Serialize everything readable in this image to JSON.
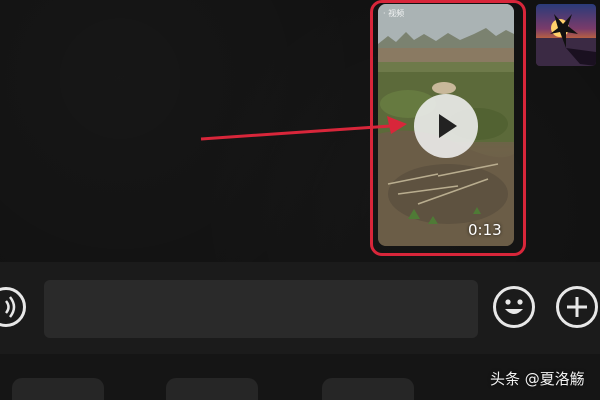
{
  "chat": {
    "video_message": {
      "duration": "0:13",
      "overlay_label": "· 视频",
      "highlight_color": "#d8263a"
    },
    "annotation_arrow_color": "#d8263a"
  },
  "input_bar": {
    "voice_icon": "voice-wave-icon",
    "message_value": "",
    "emoji_icon": "smiley-face-icon",
    "plus_icon": "plus-icon"
  },
  "watermark": {
    "text": "头条 @夏洛觞"
  }
}
